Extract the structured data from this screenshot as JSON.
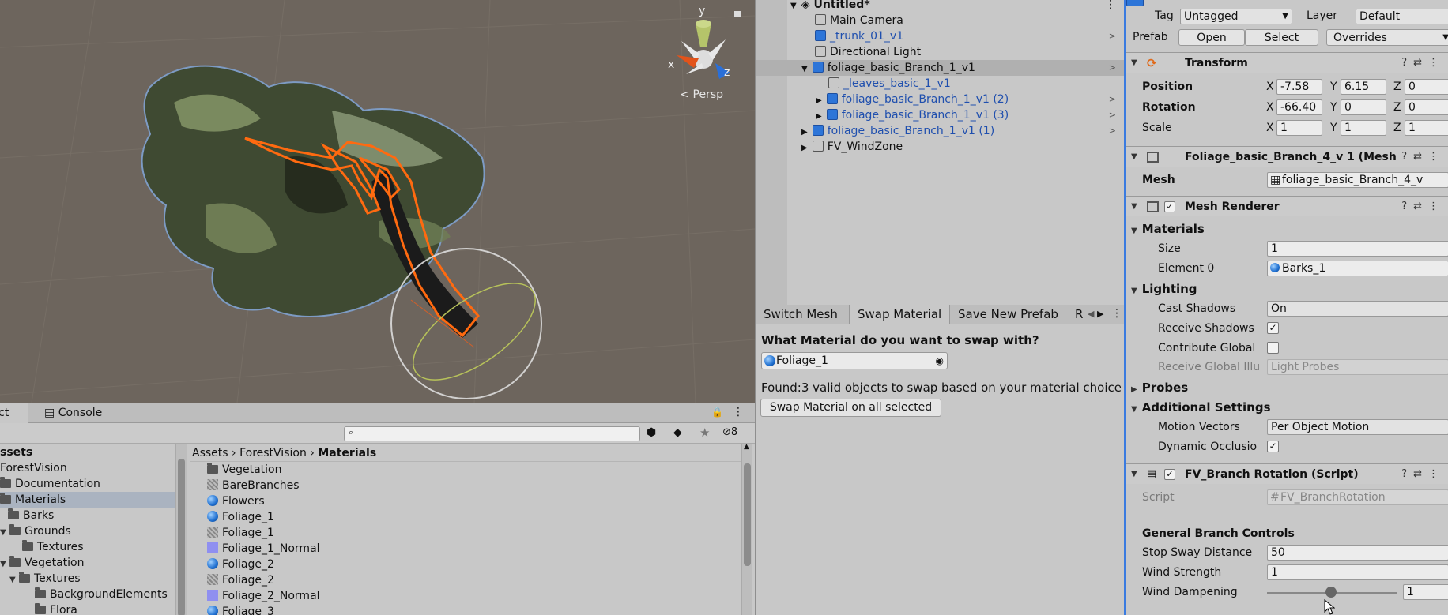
{
  "scene": {
    "persp_label": "Persp",
    "gizmo": {
      "y": "y",
      "x": "x",
      "z": "z"
    }
  },
  "hierarchy": {
    "scene_name": "Untitled*",
    "items": [
      {
        "label": "Main Camera"
      },
      {
        "label": "_trunk_01_v1"
      },
      {
        "label": "Directional Light"
      },
      {
        "label": "foliage_basic_Branch_1_v1"
      },
      {
        "label": "_leaves_basic_1_v1"
      },
      {
        "label": "foliage_basic_Branch_1_v1 (2)"
      },
      {
        "label": "foliage_basic_Branch_1_v1 (3)"
      },
      {
        "label": "foliage_basic_Branch_1_v1 (1)"
      },
      {
        "label": "FV_WindZone"
      }
    ]
  },
  "swap_panel": {
    "tabs": [
      "Switch Mesh",
      "Swap Material",
      "Save New Prefab",
      "R"
    ],
    "question": "What Material do you want to swap with?",
    "material_value": "Foliage_1",
    "found_text": "Found:3 valid objects to swap based on your material choice",
    "swap_button": "Swap Material on all selected"
  },
  "project": {
    "tabs": [
      "ct",
      "Console"
    ],
    "hidden_count": "8",
    "tree": [
      {
        "label": "ssets"
      },
      {
        "label": "ForestVision"
      },
      {
        "label": "Documentation"
      },
      {
        "label": "Materials"
      },
      {
        "label": "Barks"
      },
      {
        "label": "Grounds"
      },
      {
        "label": "Textures"
      },
      {
        "label": "Vegetation"
      },
      {
        "label": "Textures"
      },
      {
        "label": "BackgroundElements"
      },
      {
        "label": "Flora"
      }
    ],
    "breadcrumb": [
      "Assets",
      "ForestVision",
      "Materials"
    ],
    "files": [
      {
        "label": "Vegetation",
        "kind": "folder"
      },
      {
        "label": "BareBranches",
        "kind": "texture"
      },
      {
        "label": "Flowers",
        "kind": "material"
      },
      {
        "label": "Foliage_1",
        "kind": "material"
      },
      {
        "label": "Foliage_1",
        "kind": "texture"
      },
      {
        "label": "Foliage_1_Normal",
        "kind": "normal"
      },
      {
        "label": "Foliage_2",
        "kind": "material"
      },
      {
        "label": "Foliage_2",
        "kind": "texture"
      },
      {
        "label": "Foliage_2_Normal",
        "kind": "normal"
      },
      {
        "label": "Foliage_3",
        "kind": "material"
      }
    ]
  },
  "inspector": {
    "tag_label": "Tag",
    "tag_value": "Untagged",
    "layer_label": "Layer",
    "layer_value": "Default",
    "prefab_label": "Prefab",
    "prefab_open": "Open",
    "prefab_select": "Select",
    "prefab_overrides": "Overrides",
    "transform": {
      "title": "Transform",
      "position_label": "Position",
      "rotation_label": "Rotation",
      "scale_label": "Scale",
      "position": {
        "x": "-7.58",
        "y": "6.15",
        "z": "0"
      },
      "rotation": {
        "x": "-66.40",
        "y": "0",
        "z": "0"
      },
      "scale": {
        "x": "1",
        "y": "1",
        "z": "1"
      },
      "axis": {
        "x": "X",
        "y": "Y",
        "z": "Z"
      }
    },
    "mesh_filter": {
      "title": "Foliage_basic_Branch_4_v 1 (Mesh",
      "mesh_label": "Mesh",
      "mesh_value": "foliage_basic_Branch_4_v"
    },
    "mesh_renderer": {
      "title": "Mesh Renderer",
      "materials_label": "Materials",
      "size_label": "Size",
      "size_value": "1",
      "element0_label": "Element 0",
      "element0_value": "Barks_1",
      "lighting_label": "Lighting",
      "cast_shadows_label": "Cast Shadows",
      "cast_shadows_value": "On",
      "receive_shadows_label": "Receive Shadows",
      "contribute_global_label": "Contribute Global",
      "receive_gi_label": "Receive Global Illu",
      "receive_gi_value": "Light Probes",
      "probes_label": "Probes",
      "additional_label": "Additional Settings",
      "motion_vectors_label": "Motion Vectors",
      "motion_vectors_value": "Per Object Motion",
      "dynamic_occlusion_label": "Dynamic Occlusio"
    },
    "branch_rotation": {
      "title": "FV_Branch Rotation (Script)",
      "script_label": "Script",
      "script_value": "FV_BranchRotation",
      "section_label": "General Branch Controls",
      "stop_sway_label": "Stop Sway Distance",
      "stop_sway_value": "50",
      "wind_strength_label": "Wind Strength",
      "wind_strength_value": "1",
      "wind_dampening_label": "Wind Dampening",
      "wind_dampening_value": "1"
    }
  },
  "colors": {
    "scene_bg": "#6d655d",
    "selection_outline": "#ff6a10",
    "inspector_accent": "#3a7be0",
    "material_blue": "#2d75d8"
  }
}
